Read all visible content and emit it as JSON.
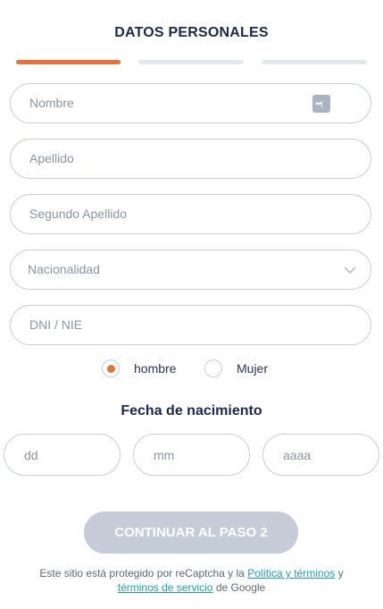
{
  "header": {
    "title": "DATOS PERSONALES"
  },
  "stepper": {
    "steps": [
      {
        "state": "active",
        "color": "#e8713a"
      },
      {
        "state": "inactive",
        "color": "#e4e7ec"
      },
      {
        "state": "inactive",
        "color": "#e4e7ec"
      }
    ]
  },
  "form": {
    "nombre": {
      "placeholder": "Nombre",
      "value": ""
    },
    "apellido": {
      "placeholder": "Apellido",
      "value": ""
    },
    "segundo_apellido": {
      "placeholder": "Segundo Apellido",
      "value": ""
    },
    "nacionalidad": {
      "placeholder": "Nacionalidad",
      "value": ""
    },
    "dni": {
      "placeholder": "DNI / NIE",
      "value": ""
    },
    "sexo": {
      "options": [
        {
          "label": "hombre",
          "checked": true
        },
        {
          "label": "Mujer",
          "checked": false
        }
      ]
    },
    "fecha": {
      "title": "Fecha de nacimiento",
      "day_placeholder": "dd",
      "month_placeholder": "mm",
      "year_placeholder": "aaaa"
    }
  },
  "actions": {
    "continue_label": "CONTINUAR AL PASO 2",
    "continue_disabled": true
  },
  "footer": {
    "text_before": "Este sitio está protegido por reCaptcha y la",
    "policy_link": "Política y términos",
    "text_middle": "y",
    "terms_link": "términos de servicio",
    "text_after": "de Google"
  },
  "colors": {
    "accent": "#e8713a",
    "link": "#1f9fb0",
    "button_disabled": "#c5ccd8"
  },
  "icons": {
    "password_manager": "password-manager-icon",
    "dropdown": "chevron-down-icon"
  }
}
